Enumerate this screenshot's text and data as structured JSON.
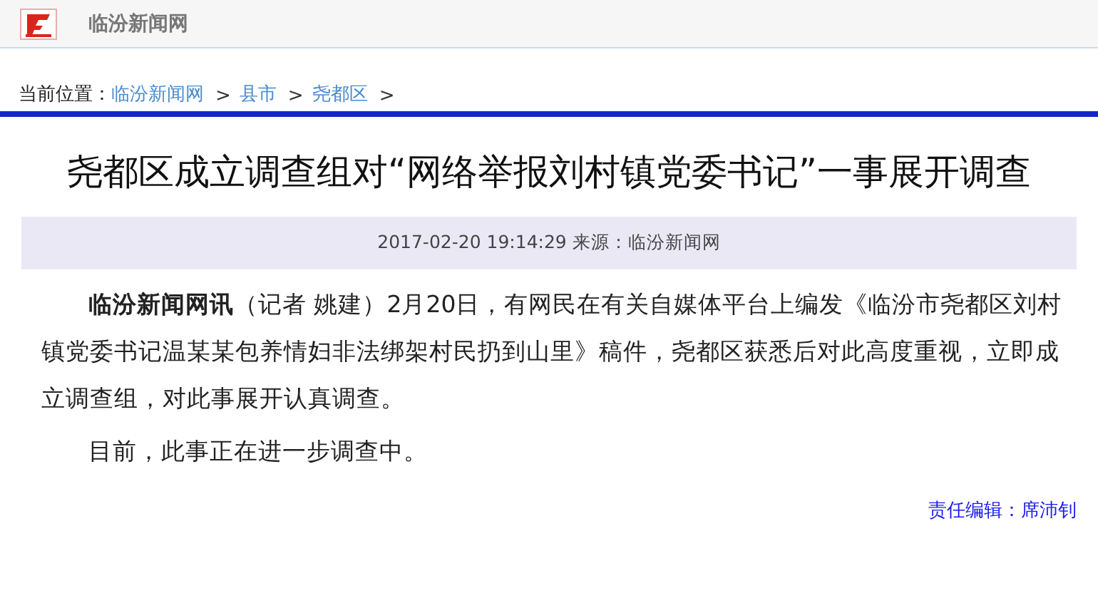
{
  "header": {
    "site_name": "临汾新闻网"
  },
  "breadcrumb": {
    "label": "当前位置：",
    "items": [
      {
        "text": "临汾新闻网",
        "separator": ">"
      },
      {
        "text": "县市",
        "separator": ">"
      },
      {
        "text": "尧都区",
        "separator": ">"
      }
    ]
  },
  "article": {
    "title": "尧都区成立调查组对“网络举报刘村镇党委书记”一事展开调查",
    "meta": "2017-02-20 19:14:29 来源：临汾新闻网",
    "paragraphs": [
      "**临汾新闻网讯**（记者 姚建）2月20日，有网民在有关自媒体平台上编发《临汾市尧都区刘村镇党委书记温某某包养情妇非法绑架村民扔到山里》稿件，尧都区获悉后对此高度重视，立即成立调查组，对此事展开认真调查。",
      "目前，此事正在进一步调查中。"
    ],
    "editor": "责任编辑：席沛钊"
  }
}
